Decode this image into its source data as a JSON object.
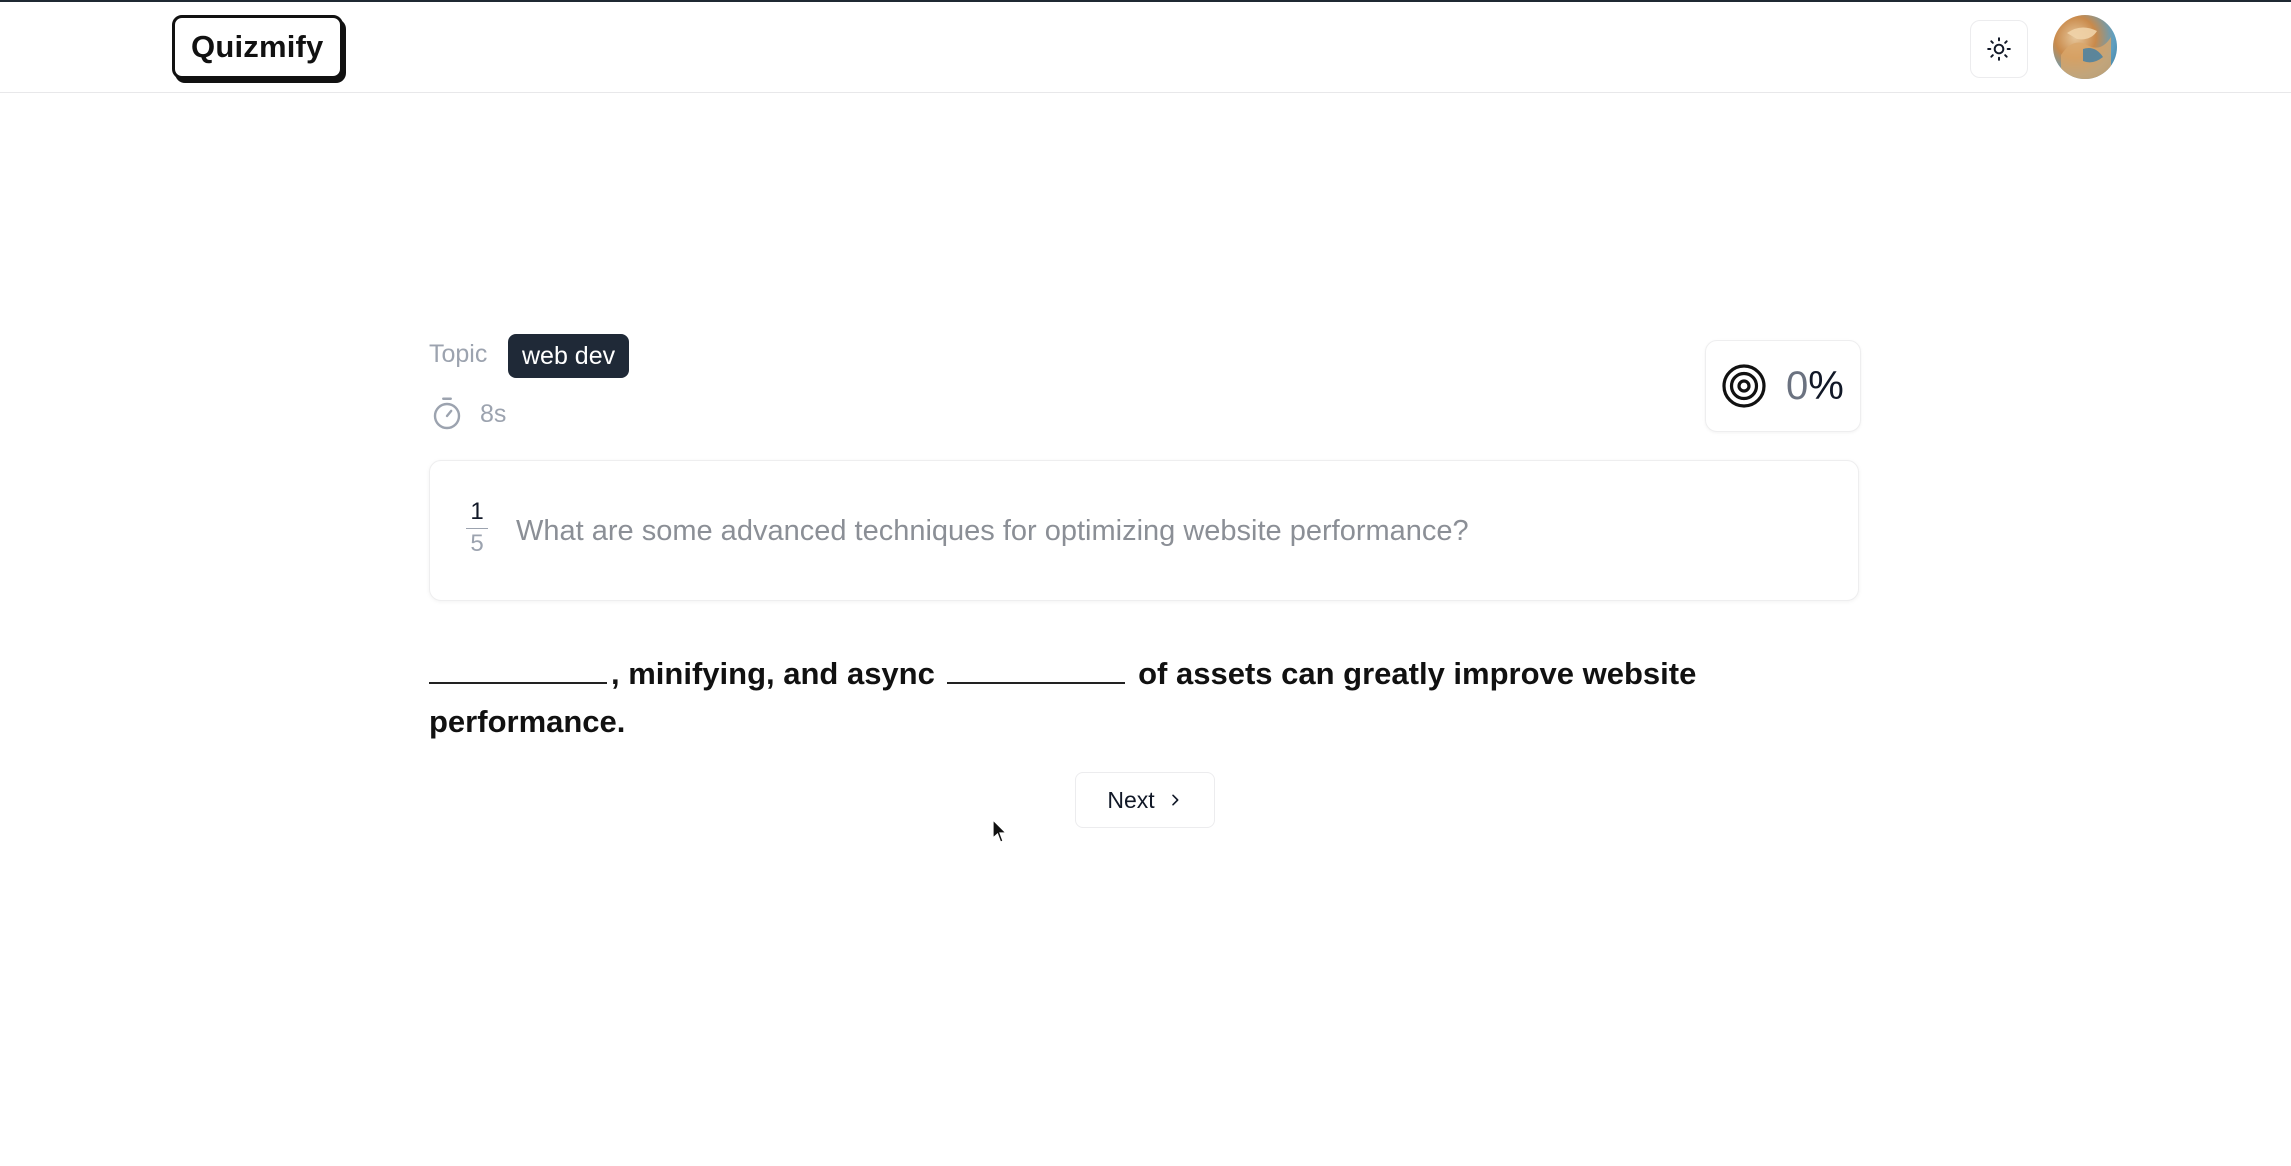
{
  "app": {
    "logo_text": "Quizmify"
  },
  "header": {
    "theme_toggle_icon": "sun-icon",
    "avatar_icon": "user-avatar"
  },
  "quiz": {
    "topic_label": "Topic",
    "topic_value": "web dev",
    "timer": "8s",
    "score": {
      "value": "0",
      "unit": "%"
    },
    "question_index": "1",
    "question_total": "5",
    "question_text": "What are some advanced techniques for optimizing website performance?",
    "answer_segments": [
      ", minifying, and async",
      "of assets can greatly improve website performance."
    ],
    "next_label": "Next"
  },
  "colors": {
    "badge_bg": "#1f2937",
    "muted_text": "#9ca3af",
    "logo_border": "#111111"
  }
}
